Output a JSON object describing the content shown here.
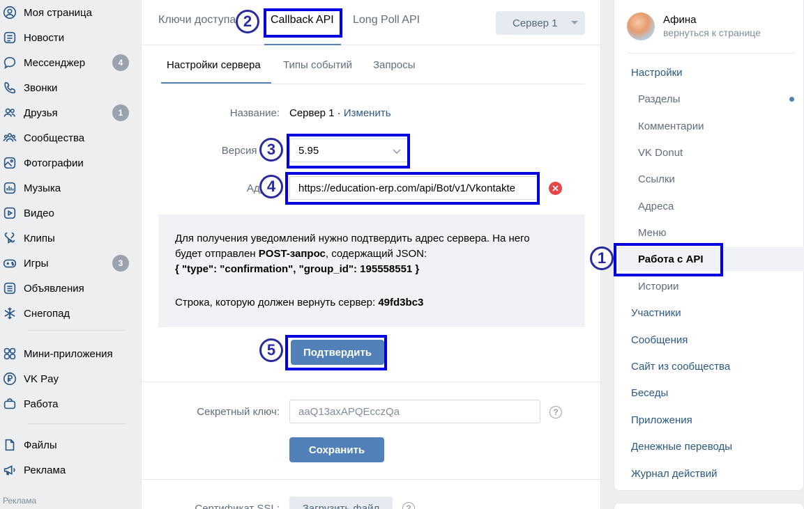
{
  "leftnav": {
    "items": [
      {
        "label": "Моя страница",
        "icon": "user-circle-icon"
      },
      {
        "label": "Новости",
        "icon": "news-icon"
      },
      {
        "label": "Мессенджер",
        "icon": "message-icon",
        "badge": "4"
      },
      {
        "label": "Звонки",
        "icon": "phone-icon"
      },
      {
        "label": "Друзья",
        "icon": "friends-icon",
        "badge": "1"
      },
      {
        "label": "Сообщества",
        "icon": "communities-icon"
      },
      {
        "label": "Фотографии",
        "icon": "photo-icon"
      },
      {
        "label": "Музыка",
        "icon": "music-icon"
      },
      {
        "label": "Видео",
        "icon": "video-icon"
      },
      {
        "label": "Клипы",
        "icon": "clips-icon"
      },
      {
        "label": "Игры",
        "icon": "gamepad-icon",
        "badge": "3"
      },
      {
        "label": "Объявления",
        "icon": "ads-list-icon"
      },
      {
        "label": "Снегопад",
        "icon": "snowflake-icon"
      },
      {
        "label": "Мини-приложения",
        "icon": "apps-icon"
      },
      {
        "label": "VK Pay",
        "icon": "ruble-icon"
      },
      {
        "label": "Работа",
        "icon": "briefcase-icon"
      },
      {
        "label": "Файлы",
        "icon": "file-icon"
      },
      {
        "label": "Реклама",
        "icon": "megaphone-icon"
      }
    ],
    "ad_label": "Реклама"
  },
  "main": {
    "tabs": [
      "Ключи доступа",
      "Callback API",
      "Long Poll API"
    ],
    "server_select": "Сервер 1",
    "subtabs": [
      "Настройки сервера",
      "Типы событий",
      "Запросы"
    ],
    "name_label": "Название:",
    "name_value": "Сервер 1 · ",
    "name_change": "Изменить",
    "version_label": "Версия API:",
    "version_value": "5.95",
    "address_label": "Адрес:",
    "address_value": "https://education-erp.com/api/Bot/v1/Vkontakte",
    "info": {
      "line1": "Для получения уведомлений нужно подтвердить адрес сервера. На него",
      "line2_pre": "будет отправлен ",
      "line2_bold": "POST-запрос",
      "line2_post": ", содержащий JSON:",
      "json": "{ \"type\": \"confirmation\", \"group_id\": 195558551 }",
      "return_pre": "Строка, которую должен вернуть сервер: ",
      "return_code": "49fd3bc3"
    },
    "confirm_button": "Подтвердить",
    "secret_label": "Секретный ключ:",
    "secret_placeholder": "aaQ13axAPQEcczQa",
    "save_button": "Сохранить",
    "ssl_label": "Сертификат SSL:",
    "upload_button": "Загрузить файл",
    "help_glyph": "?"
  },
  "rightmenu": {
    "user_name": "Афина",
    "user_back": "вернуться к странице",
    "items": [
      {
        "label": "Настройки",
        "level": "top"
      },
      {
        "label": "Разделы",
        "level": "sub"
      },
      {
        "label": "Комментарии",
        "level": "sub"
      },
      {
        "label": "VK Donut",
        "level": "sub"
      },
      {
        "label": "Ссылки",
        "level": "sub"
      },
      {
        "label": "Адреса",
        "level": "sub"
      },
      {
        "label": "Меню",
        "level": "sub"
      },
      {
        "label": "Работа с API",
        "level": "sub",
        "selected": true
      },
      {
        "label": "Истории",
        "level": "sub"
      },
      {
        "label": "Участники",
        "level": "top"
      },
      {
        "label": "Сообщения",
        "level": "top"
      },
      {
        "label": "Сайт из сообщества",
        "level": "top"
      },
      {
        "label": "Беседы",
        "level": "top"
      },
      {
        "label": "Приложения",
        "level": "top"
      },
      {
        "label": "Денежные переводы",
        "level": "top"
      },
      {
        "label": "Журнал действий",
        "level": "top"
      }
    ]
  },
  "annotations": [
    "1",
    "2",
    "3",
    "4",
    "5"
  ],
  "colors": {
    "accent": "#5181b8",
    "link": "#2a5885",
    "highlight": "#0000e0",
    "clear": "#e64646"
  }
}
